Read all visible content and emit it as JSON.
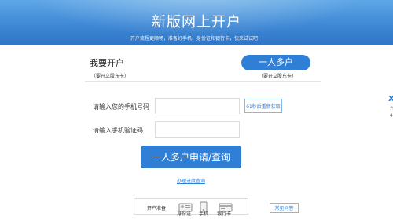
{
  "banner": {
    "title": "新版网上开户",
    "subtitle": "开户流程更顺畅，准备好手机、身份证和银行卡，快来试试吧！"
  },
  "options": {
    "left": {
      "title": "我要开户",
      "sub": "（要开立股东卡）"
    },
    "right": {
      "title": "一人多户",
      "sub": "（要开立股东卡）"
    }
  },
  "form": {
    "phone_label": "请输入您的手机号码",
    "phone_value": "",
    "code_label": "请输入手机验证码",
    "code_value": "",
    "resend_label": "61秒后重新获取",
    "submit_label": "一人多户申请/查询"
  },
  "links": {
    "progress": "办理进度查询"
  },
  "prepare": {
    "label": "开户准备：",
    "items": [
      "身份证",
      "手机",
      "银行卡"
    ],
    "faq_label": "常见问答"
  },
  "edge": {
    "x": "X",
    "a": "开",
    "b": "4"
  },
  "colors": {
    "accent": "#2f7fd6",
    "banner": "#3f89d6"
  }
}
